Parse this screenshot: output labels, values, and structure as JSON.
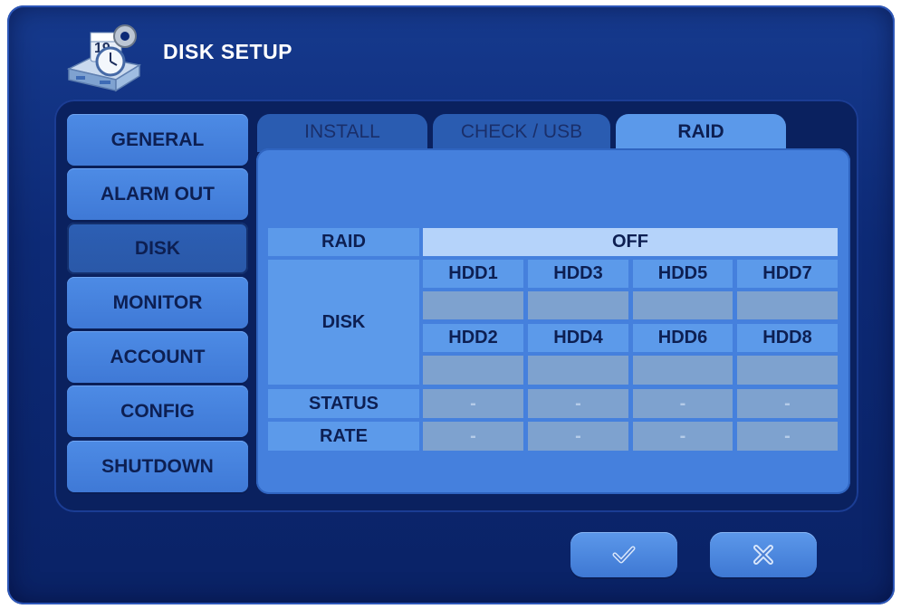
{
  "window": {
    "title": "DISK SETUP",
    "calendar_number": "19"
  },
  "sidebar": {
    "items": [
      {
        "label": "GENERAL"
      },
      {
        "label": "ALARM OUT"
      },
      {
        "label": "DISK",
        "active": true
      },
      {
        "label": "MONITOR"
      },
      {
        "label": "ACCOUNT"
      },
      {
        "label": "CONFIG"
      },
      {
        "label": "SHUTDOWN"
      }
    ]
  },
  "tabs": [
    {
      "label": "INSTALL"
    },
    {
      "label": "CHECK / USB"
    },
    {
      "label": "RAID",
      "active": true
    }
  ],
  "raid": {
    "raid_label": "RAID",
    "raid_value": "OFF",
    "disk_label": "DISK",
    "row1": [
      "HDD1",
      "HDD3",
      "HDD5",
      "HDD7"
    ],
    "row2": [
      "HDD2",
      "HDD4",
      "HDD6",
      "HDD8"
    ],
    "status_label": "STATUS",
    "status_values": [
      "-",
      "-",
      "-",
      "-"
    ],
    "rate_label": "RATE",
    "rate_values": [
      "-",
      "-",
      "-",
      "-"
    ]
  },
  "buttons": {
    "ok_icon": "checkmark-icon",
    "cancel_icon": "close-icon"
  },
  "colors": {
    "background": "#0d2a76",
    "active_tab": "#5b99ea",
    "value_cell": "#b5d3fa"
  }
}
